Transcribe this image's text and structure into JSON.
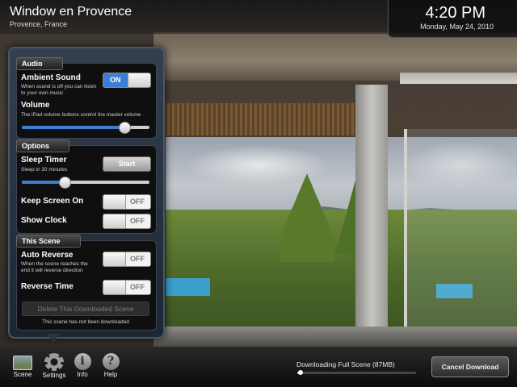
{
  "header": {
    "title": "Window en Provence",
    "location": "Provence, France",
    "time": "4:20 PM",
    "date": "Monday, May 24, 2010"
  },
  "audio": {
    "heading": "Audio",
    "ambient_label": "Ambient Sound",
    "ambient_help": "When sound is off you can listen to your own music",
    "ambient_state": "ON",
    "volume_label": "Volume",
    "volume_help": "The iPad volume buttons control the master volume",
    "volume_level": 0.8
  },
  "options": {
    "heading": "Options",
    "sleep_label": "Sleep Timer",
    "sleep_help": "Sleep in 30 minutes",
    "start_label": "Start",
    "sleep_level": 0.33,
    "keep_screen_label": "Keep Screen On",
    "keep_screen_state": "OFF",
    "show_clock_label": "Show Clock",
    "show_clock_state": "OFF"
  },
  "this_scene": {
    "heading": "This Scene",
    "auto_reverse_label": "Auto Reverse",
    "auto_reverse_help": "When the scene reaches the end it will reverse direction",
    "auto_reverse_state": "OFF",
    "reverse_time_label": "Reverse Time",
    "reverse_time_state": "OFF",
    "delete_label": "Delete This Downloaded Scene",
    "note": "This scene has not been downloaded"
  },
  "toolbar": {
    "items": [
      {
        "label": "Scene",
        "icon": "landscape-icon"
      },
      {
        "label": "Settings",
        "icon": "gear-icon"
      },
      {
        "label": "Info",
        "icon": "info-icon"
      },
      {
        "label": "Help",
        "icon": "help-icon"
      }
    ]
  },
  "download": {
    "label": "Downloading Full Scene (87MB)",
    "progress": 0.03,
    "cancel_label": "Cancel Download"
  }
}
